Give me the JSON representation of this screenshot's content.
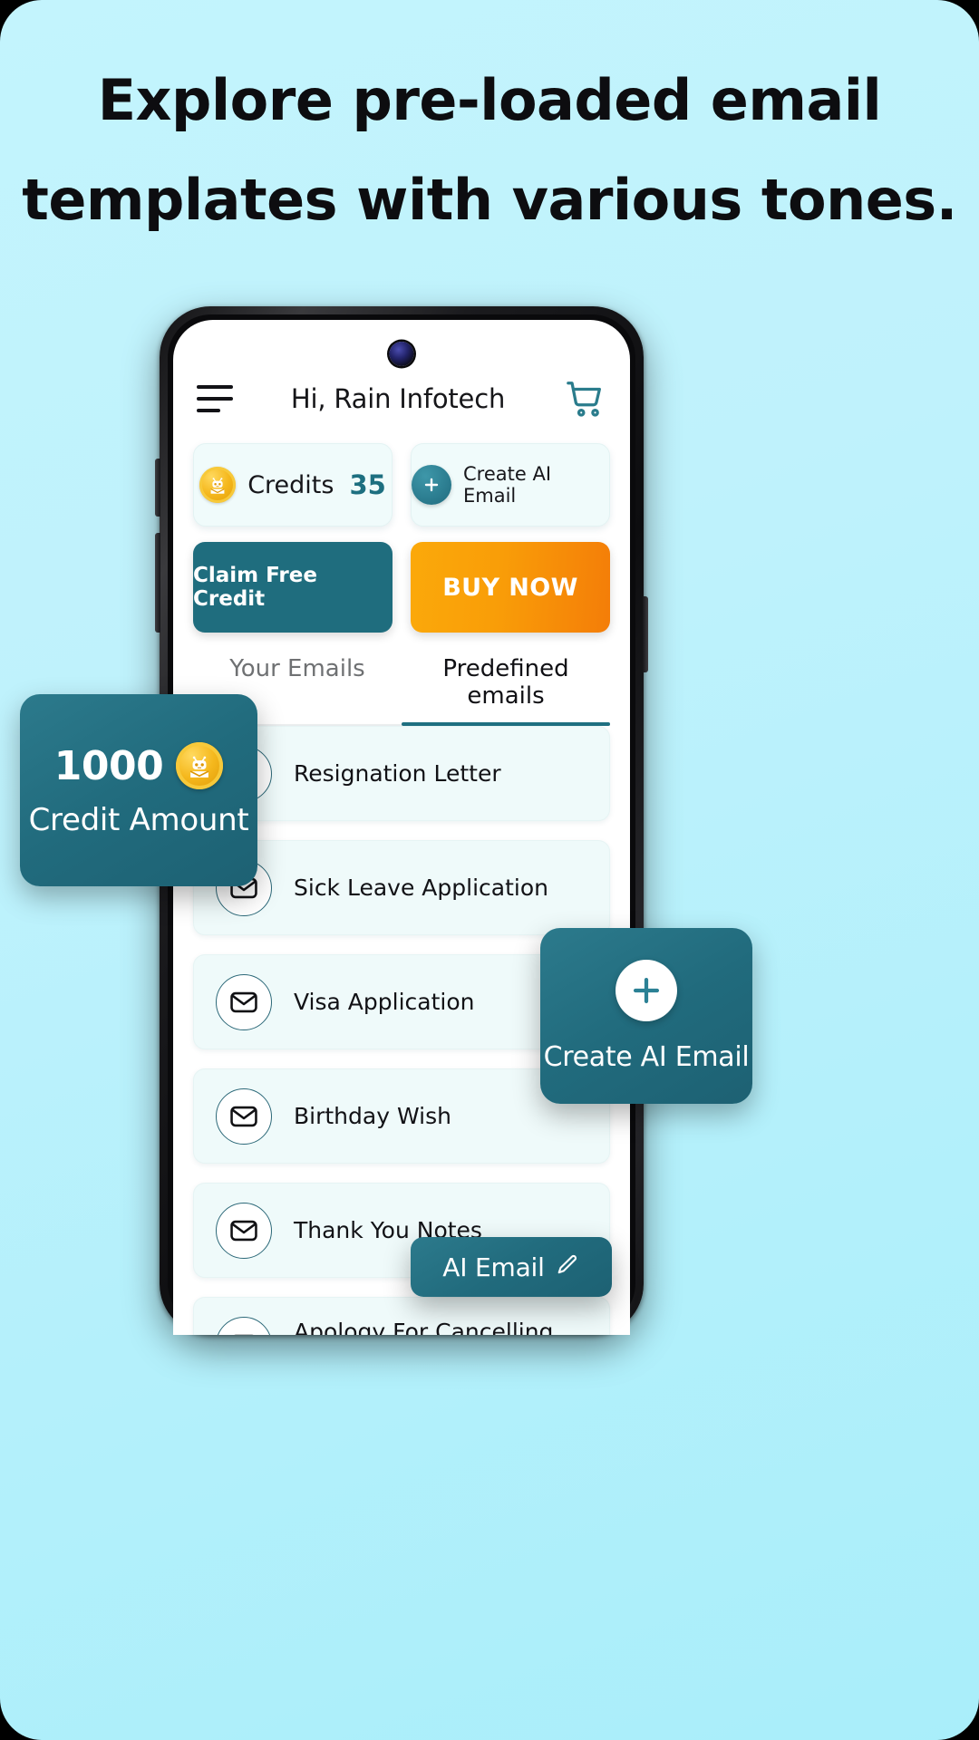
{
  "promo": {
    "headline_line1": "Explore pre-loaded email",
    "headline_line2": "templates with various tones.",
    "background_color": "#bff2fc",
    "accent_color": "#1f6d7e",
    "orange_color": "#f99d08"
  },
  "app": {
    "header": {
      "menu_icon": "hamburger-menu-icon",
      "title": "Hi, Rain Infotech",
      "cart_icon": "shopping-cart-icon"
    },
    "credits_card": {
      "coin_icon": "ai-robot-coin-icon",
      "label": "Credits",
      "value": "35"
    },
    "create_card": {
      "plus_icon": "plus-icon",
      "label": "Create AI Email"
    },
    "buttons": {
      "claim": "Claim Free Credit",
      "buy": "BUY NOW"
    },
    "tabs": [
      {
        "label": "Your Emails",
        "active": false
      },
      {
        "label": "Predefined emails",
        "active": true
      }
    ],
    "emails": [
      {
        "icon": "envelope-icon",
        "name": "Resignation Letter"
      },
      {
        "icon": "envelope-icon",
        "name": "Sick Leave Application"
      },
      {
        "icon": "envelope-icon",
        "name": "Visa Application"
      },
      {
        "icon": "envelope-icon",
        "name": "Birthday Wish"
      },
      {
        "icon": "envelope-icon",
        "name": "Thank You Notes"
      },
      {
        "icon": "envelope-icon",
        "name": "Apology For Cancelling Event"
      }
    ]
  },
  "callouts": {
    "credit": {
      "amount": "1000",
      "label": "Credit Amount",
      "coin_icon": "ai-robot-coin-icon"
    },
    "create": {
      "plus_icon": "plus-icon",
      "label": "Create AI Email"
    },
    "ai_email": {
      "label": "AI Email",
      "icon": "pencil-edit-icon"
    }
  }
}
